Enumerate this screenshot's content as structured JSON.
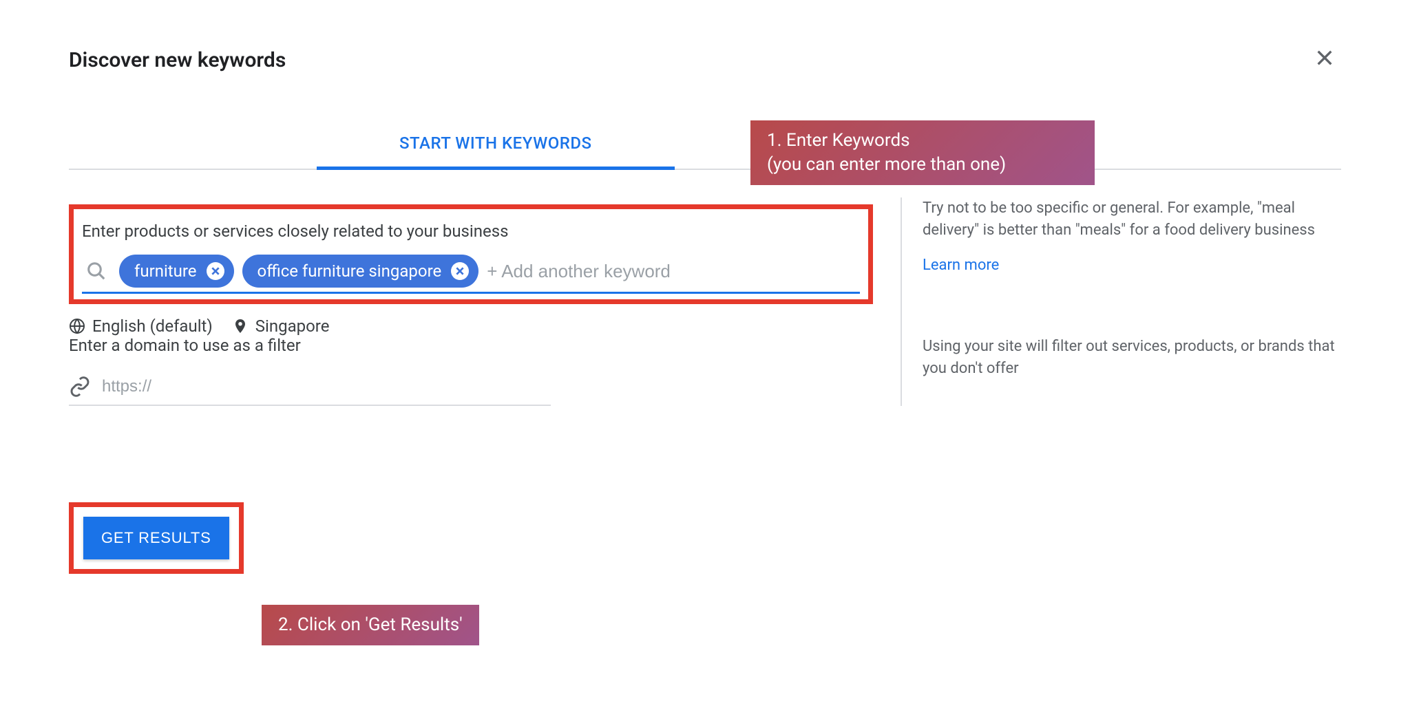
{
  "header": {
    "title": "Discover new keywords"
  },
  "tabs": {
    "keywords_label": "START WITH KEYWORDS"
  },
  "annotations": {
    "step1_line1": "1.   Enter Keywords",
    "step1_line2": "(you can enter more than one)",
    "step2": "2. Click on 'Get Results'"
  },
  "keywords_section": {
    "label": "Enter products or services closely related to your business",
    "chips": [
      "furniture",
      "office furniture singapore"
    ],
    "placeholder": "+ Add another keyword"
  },
  "locale": {
    "language": "English (default)",
    "location": "Singapore"
  },
  "help": {
    "keywords_tip": "Try not to be too specific or general. For example, \"meal delivery\" is better than \"meals\" for a food delivery business",
    "learn_more": "Learn more",
    "domain_tip": "Using your site will filter out services, products, or brands that you don't offer"
  },
  "domain_section": {
    "label": "Enter a domain to use as a filter",
    "placeholder": "https://"
  },
  "actions": {
    "get_results": "GET RESULTS"
  }
}
